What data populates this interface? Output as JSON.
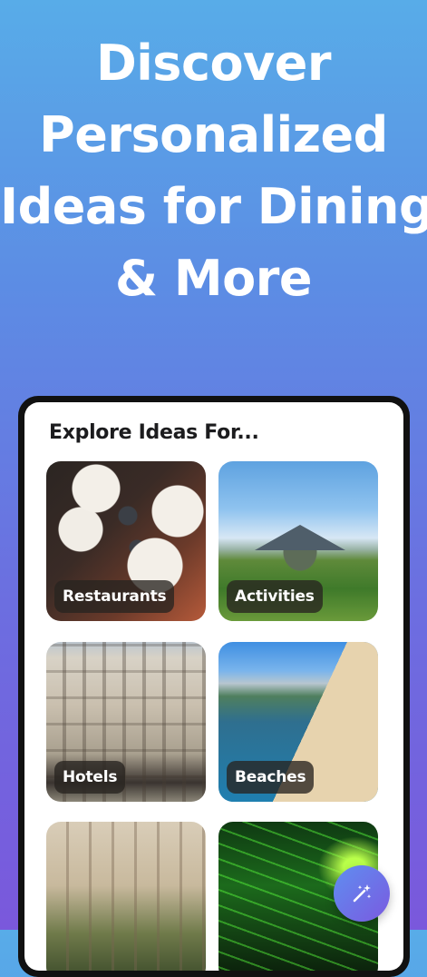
{
  "headline": {
    "lines": [
      "Discover",
      "Personalized",
      "Ideas for Dining",
      "& More"
    ]
  },
  "explore": {
    "title": "Explore Ideas For...",
    "categories": [
      {
        "label": "Restaurants",
        "image": "restaurants-photo"
      },
      {
        "label": "Activities",
        "image": "activities-photo"
      },
      {
        "label": "Hotels",
        "image": "hotels-photo"
      },
      {
        "label": "Beaches",
        "image": "beaches-photo"
      },
      {
        "label": "",
        "image": "shopping-mall-photo"
      },
      {
        "label": "",
        "image": "nightlife-photo"
      }
    ]
  },
  "fab": {
    "icon": "magic-wand-icon"
  },
  "colors": {
    "gradient_top": "#58ace8",
    "gradient_bottom": "#7a58dc",
    "label_bg": "#28241f",
    "fab_start": "#5f8ef0",
    "fab_end": "#7a5ae0"
  }
}
